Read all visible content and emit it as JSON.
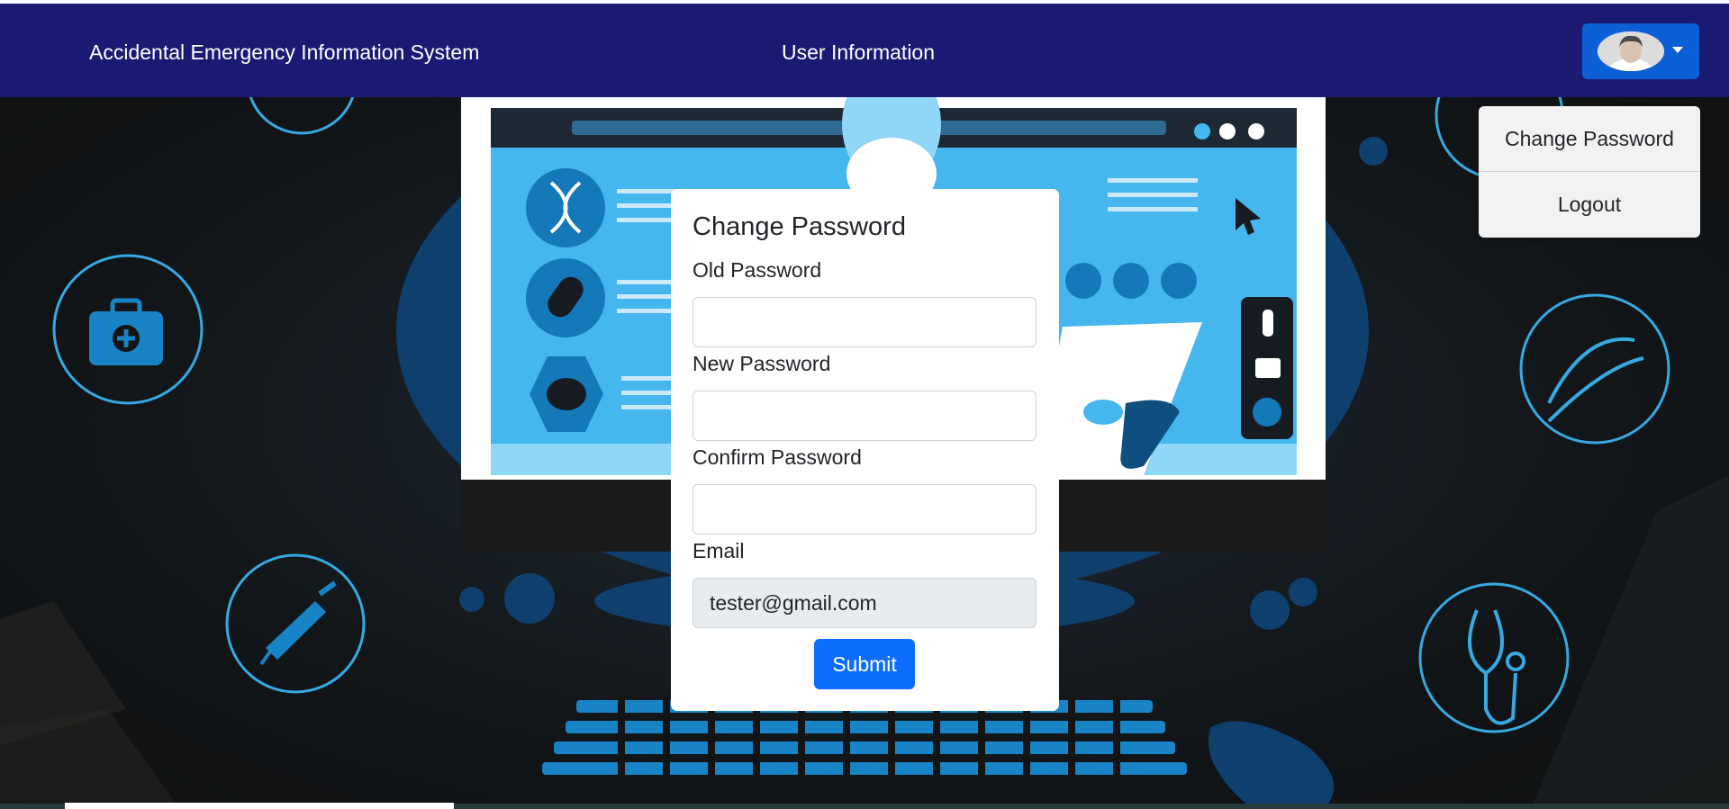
{
  "navbar": {
    "brand": "Accidental Emergency Information System",
    "center_link": "User Information"
  },
  "user_menu": {
    "items": [
      "Change Password",
      "Logout"
    ]
  },
  "form": {
    "title": "Change Password",
    "old_password_label": "Old Password",
    "new_password_label": "New Password",
    "confirm_password_label": "Confirm Password",
    "email_label": "Email",
    "email_value": "tester@gmail.com",
    "submit_label": "Submit"
  },
  "colors": {
    "navbar": "#1b1a72",
    "primary_button": "#0d6efd",
    "illustration_accent": "#36a9e1"
  },
  "icons": [
    "user-avatar-icon",
    "caret-down-icon",
    "medical-kit-icon",
    "syringe-icon",
    "dna-icon",
    "stethoscope-icon"
  ]
}
